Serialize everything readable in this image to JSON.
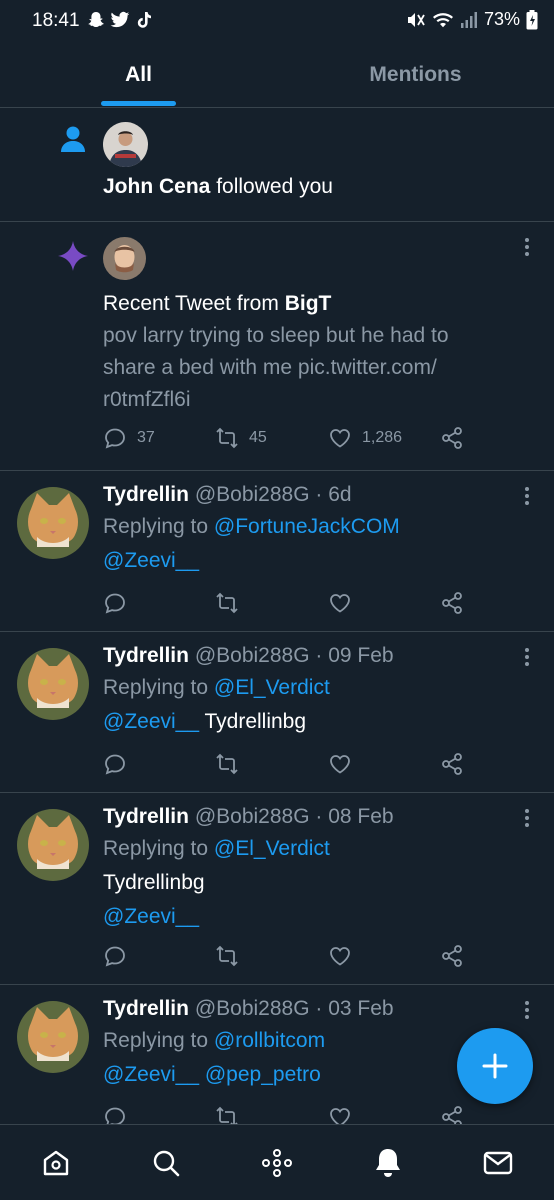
{
  "status": {
    "time": "18:41",
    "battery": "73%"
  },
  "tabs": [
    {
      "label": "All"
    },
    {
      "label": "Mentions"
    }
  ],
  "notifications": [
    {
      "type": "follow",
      "user": "John Cena",
      "text": " followed you"
    },
    {
      "type": "recent",
      "prefix": "Recent Tweet from ",
      "user": "BigT",
      "lines": [
        "pov larry trying to sleep but he had to",
        "share a bed with me pic.twitter.com/",
        "r0tmfZfl6i"
      ],
      "replies": "37",
      "retweets": "45",
      "likes": "1,286"
    }
  ],
  "replies": [
    {
      "name": "Tydrellin",
      "handle": "@Bobi288G",
      "time": " · 6d",
      "replying_label": "Replying to ",
      "to": "@FortuneJackCOM",
      "line2a": "@Zeevi__",
      "line2b": "",
      "line3": ""
    },
    {
      "name": "Tydrellin",
      "handle": "@Bobi288G",
      "time": " · 09 Feb",
      "replying_label": "Replying to ",
      "to": "@El_Verdict",
      "line2a": "@Zeevi__",
      "line2b": " Tydrellinbg",
      "line3": ""
    },
    {
      "name": "Tydrellin",
      "handle": "@Bobi288G",
      "time": " · 08 Feb",
      "replying_label": "Replying to ",
      "to": "@El_Verdict",
      "line2a": "Tydrellinbg",
      "line2b": "",
      "line3": "@Zeevi__"
    },
    {
      "name": "Tydrellin",
      "handle": "@Bobi288G",
      "time": " · 03 Feb",
      "replying_label": "Replying to ",
      "to": "@rollbitcom",
      "line2a": "@Zeevi__",
      "line2b": " @pep_petro",
      "line3": ""
    }
  ],
  "colors": {
    "background": "#15202b",
    "accent": "#1d9bf0",
    "divider": "#38444d",
    "secondary_text": "#8b98a5",
    "sparkle": "#794bc4"
  },
  "icons": [
    "person-icon",
    "sparkle-icon",
    "reply-icon",
    "retweet-icon",
    "like-icon",
    "share-icon",
    "more-icon",
    "compose-icon",
    "home-icon",
    "search-icon",
    "spaces-icon",
    "notifications-icon",
    "messages-icon"
  ]
}
